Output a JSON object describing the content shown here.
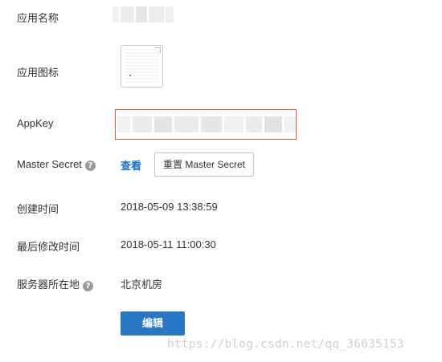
{
  "fields": {
    "app_name_label": "应用名称",
    "app_icon_label": "应用图标",
    "appkey_label": "AppKey",
    "master_secret_label": "Master Secret",
    "created_time_label": "创建时间",
    "modified_time_label": "最后修改时间",
    "server_location_label": "服务器所在地"
  },
  "values": {
    "created_time": "2018-05-09 13:38:59",
    "modified_time": "2018-05-11 11:00:30",
    "server_location": "北京机房"
  },
  "actions": {
    "view_link": "查看",
    "reset_button": "重置 Master Secret",
    "edit_button": "编辑"
  },
  "help_icon_glyph": "?",
  "watermark": "https://blog.csdn.net/qq_36635153",
  "colors": {
    "link": "#1a73c8",
    "primary_button": "#2777c5",
    "highlight_border": "#d9534f",
    "help_icon": "#9a9a9a"
  },
  "icons": [
    "help-icon",
    "app-icon-thumbnail"
  ]
}
